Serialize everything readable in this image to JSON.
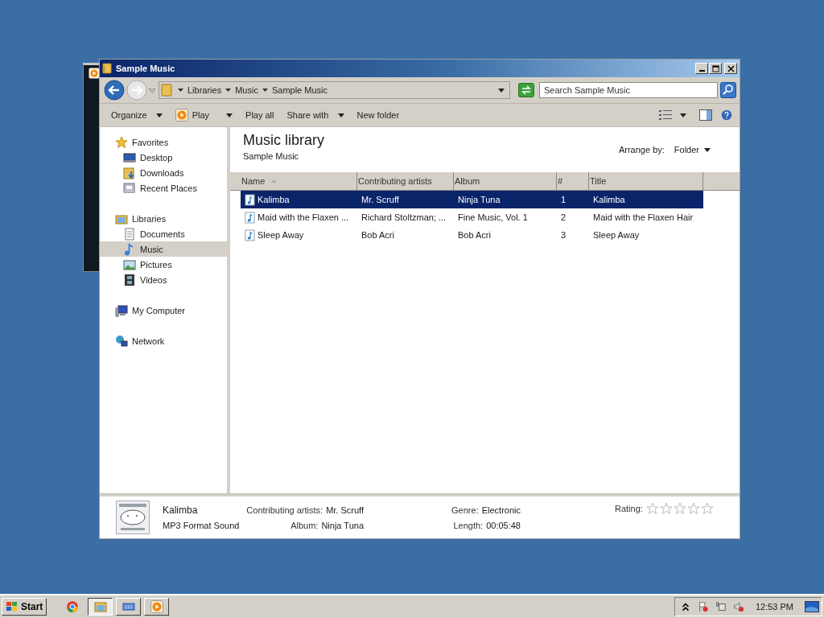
{
  "window": {
    "title": "Sample Music"
  },
  "address": {
    "crumbs": [
      "Libraries",
      "Music",
      "Sample Music"
    ]
  },
  "search": {
    "placeholder": "Search Sample Music"
  },
  "toolbar": [
    {
      "label": "Organize",
      "kind": "menu"
    },
    {
      "label": "Play",
      "kind": "split"
    },
    {
      "label": "Play all",
      "kind": "plain"
    },
    {
      "label": "Share with",
      "kind": "menu"
    },
    {
      "label": "New folder",
      "kind": "plain"
    }
  ],
  "nav": [
    {
      "label": "Favorites",
      "selected": false,
      "children": [
        {
          "label": "Desktop",
          "selected": false
        },
        {
          "label": "Downloads",
          "selected": false
        },
        {
          "label": "Recent Places",
          "selected": false
        }
      ]
    },
    {
      "label": "Libraries",
      "selected": false,
      "children": [
        {
          "label": "Documents",
          "selected": false
        },
        {
          "label": "Music",
          "selected": true
        },
        {
          "label": "Pictures",
          "selected": false
        },
        {
          "label": "Videos",
          "selected": false
        }
      ]
    },
    {
      "label": "My Computer",
      "selected": false
    },
    {
      "label": "Network",
      "selected": false
    }
  ],
  "library": {
    "title": "Music library",
    "subtitle": "Sample Music",
    "arrange_label": "Arrange by:",
    "arrange_value": "Folder"
  },
  "table": {
    "columns": [
      {
        "label": "Name",
        "sorted": true
      },
      {
        "label": "Contributing artists",
        "sorted": false
      },
      {
        "label": "Album",
        "sorted": false
      },
      {
        "label": "#",
        "sorted": false
      },
      {
        "label": "Title",
        "sorted": false
      }
    ],
    "rows": [
      {
        "selected": true,
        "cells": [
          "Kalimba",
          "Mr. Scruff",
          "Ninja Tuna",
          "1",
          "Kalimba"
        ]
      },
      {
        "selected": false,
        "cells": [
          "Maid with the Flaxen ...",
          "Richard Stoltzman; ...",
          "Fine Music, Vol. 1",
          "2",
          "Maid with the Flaxen Hair"
        ]
      },
      {
        "selected": false,
        "cells": [
          "Sleep Away",
          "Bob Acri",
          "Bob Acri",
          "3",
          "Sleep Away"
        ]
      }
    ]
  },
  "details": {
    "title": "Kalimba",
    "type": "MP3 Format Sound",
    "fields": [
      {
        "label": "Contributing artists:",
        "value": "Mr. Scruff"
      },
      {
        "label": "Album:",
        "value": "Ninja Tuna"
      },
      {
        "label": "Genre:",
        "value": "Electronic"
      },
      {
        "label": "Length:",
        "value": "00:05:48"
      }
    ],
    "rating_label": "Rating:",
    "stars": 0
  },
  "taskbar": {
    "start": "Start",
    "apps": [
      {
        "selected": false
      },
      {
        "selected": true
      },
      {
        "selected": false
      },
      {
        "selected": false
      }
    ],
    "clock": "12:53 PM"
  }
}
